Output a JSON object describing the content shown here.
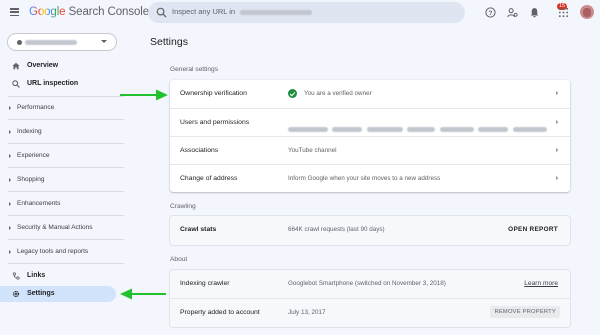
{
  "app": {
    "name": "Google Search Console",
    "logo_google": "Google",
    "logo_product": "Search Console"
  },
  "search": {
    "placeholder": "Inspect any URL in"
  },
  "topbar": {
    "notification_count": "15",
    "icons": [
      "help-icon",
      "manage-accounts-icon",
      "notifications-icon",
      "apps-grid-icon"
    ]
  },
  "sidebar": {
    "items": [
      {
        "label": "Overview",
        "icon": "home-icon"
      },
      {
        "label": "URL inspection",
        "icon": "search-icon"
      },
      {
        "label": "Performance"
      },
      {
        "label": "Indexing"
      },
      {
        "label": "Experience"
      },
      {
        "label": "Shopping"
      },
      {
        "label": "Enhancements"
      },
      {
        "label": "Security & Manual Actions"
      },
      {
        "label": "Legacy tools and reports"
      },
      {
        "label": "Links",
        "icon": "links-icon"
      },
      {
        "label": "Settings",
        "icon": "gear-icon"
      }
    ]
  },
  "main": {
    "title": "Settings",
    "general": {
      "label": "General settings",
      "rows": [
        {
          "key": "Ownership verification",
          "value": "You are a verified owner"
        },
        {
          "key": "Users and permissions",
          "value": ""
        },
        {
          "key": "Associations",
          "value": "YouTube channel"
        },
        {
          "key": "Change of address",
          "value": "Inform Google when your site moves to a new address"
        }
      ]
    },
    "crawling": {
      "label": "Crawling",
      "row": {
        "key": "Crawl stats",
        "value": "664K crawl requests (last 90 days)",
        "action": "OPEN REPORT"
      }
    },
    "about": {
      "label": "About",
      "rows": [
        {
          "key": "Indexing crawler",
          "value": "Googlebot Smartphone (switched on November 3, 2018)",
          "action": "Learn more"
        },
        {
          "key": "Property added to account",
          "value": "July 13, 2017",
          "action": "REMOVE PROPERTY"
        }
      ]
    }
  },
  "colors": {
    "accent_active": "#d2e3fc",
    "verified_green": "#1e8e3e",
    "arrow_green": "#22c22e",
    "badge_red": "#d93025"
  }
}
